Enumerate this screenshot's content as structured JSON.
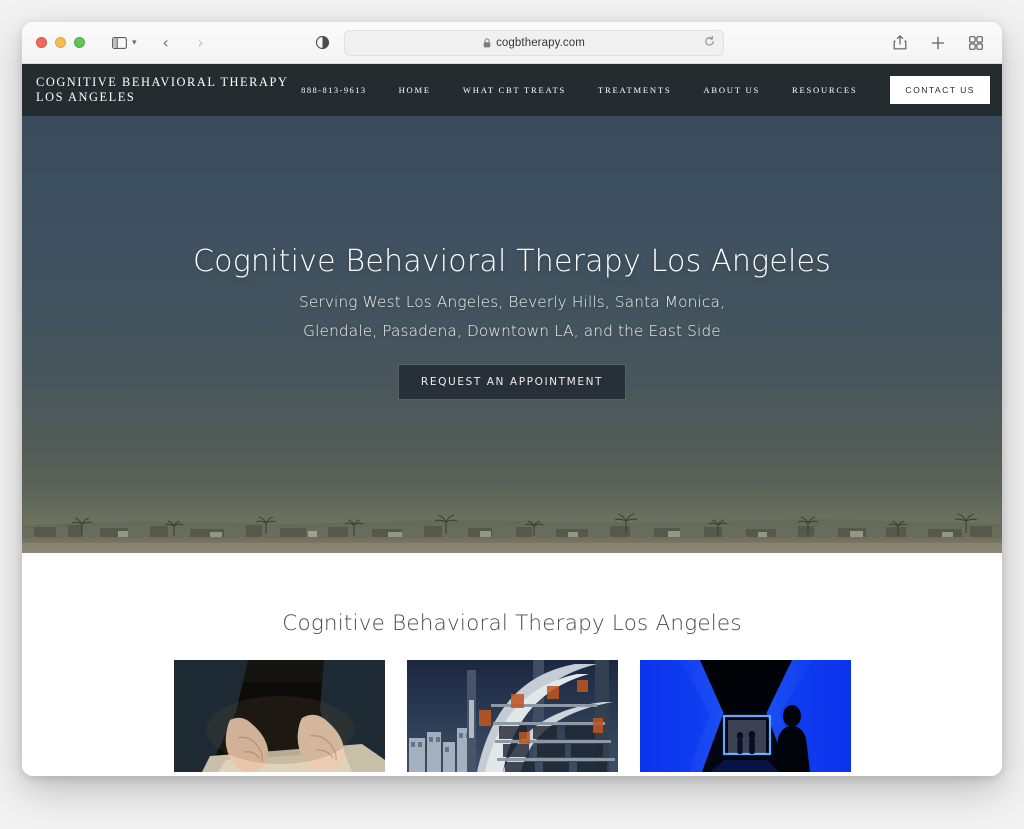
{
  "browser": {
    "url": "cogbtherapy.com",
    "lock_icon": "lock-icon",
    "reload_icon": "reload-icon",
    "sidebar_icon": "sidebar-toggle-icon",
    "back_arrow": "‹",
    "forward_arrow": "›",
    "reader_icon": "reader-mode-icon",
    "share_icon": "share-icon",
    "new_tab_icon": "new-tab-plus-icon",
    "tab_overview_icon": "tab-overview-icon"
  },
  "site_header": {
    "logo_line1": "COGNITIVE BEHAVIORAL THERAPY",
    "logo_line2": "LOS ANGELES",
    "phone": "888-813-9613",
    "nav": [
      {
        "label": "HOME"
      },
      {
        "label": "WHAT CBT TREATS"
      },
      {
        "label": "TREATMENTS"
      },
      {
        "label": "ABOUT US"
      },
      {
        "label": "RESOURCES"
      }
    ],
    "contact_button": "CONTACT US"
  },
  "hero": {
    "title": "Cognitive Behavioral Therapy Los Angeles",
    "subtitle_line1": "Serving West Los Angeles, Beverly Hills, Santa Monica,",
    "subtitle_line2": "Glendale, Pasadena, Downtown LA, and the East Side",
    "cta_label": "REQUEST AN APPOINTMENT"
  },
  "content": {
    "section_title": "Cognitive Behavioral Therapy Los Angeles",
    "cards": [
      {
        "name": "card-hands-image"
      },
      {
        "name": "card-library-image"
      },
      {
        "name": "card-blue-corridor-image"
      }
    ]
  },
  "colors": {
    "header_bg": "#252c30",
    "hero_top": "#3a4b5b",
    "hero_bottom": "#7b7d6d",
    "accent_white": "#ffffff",
    "section_text": "#4a4a4a"
  }
}
